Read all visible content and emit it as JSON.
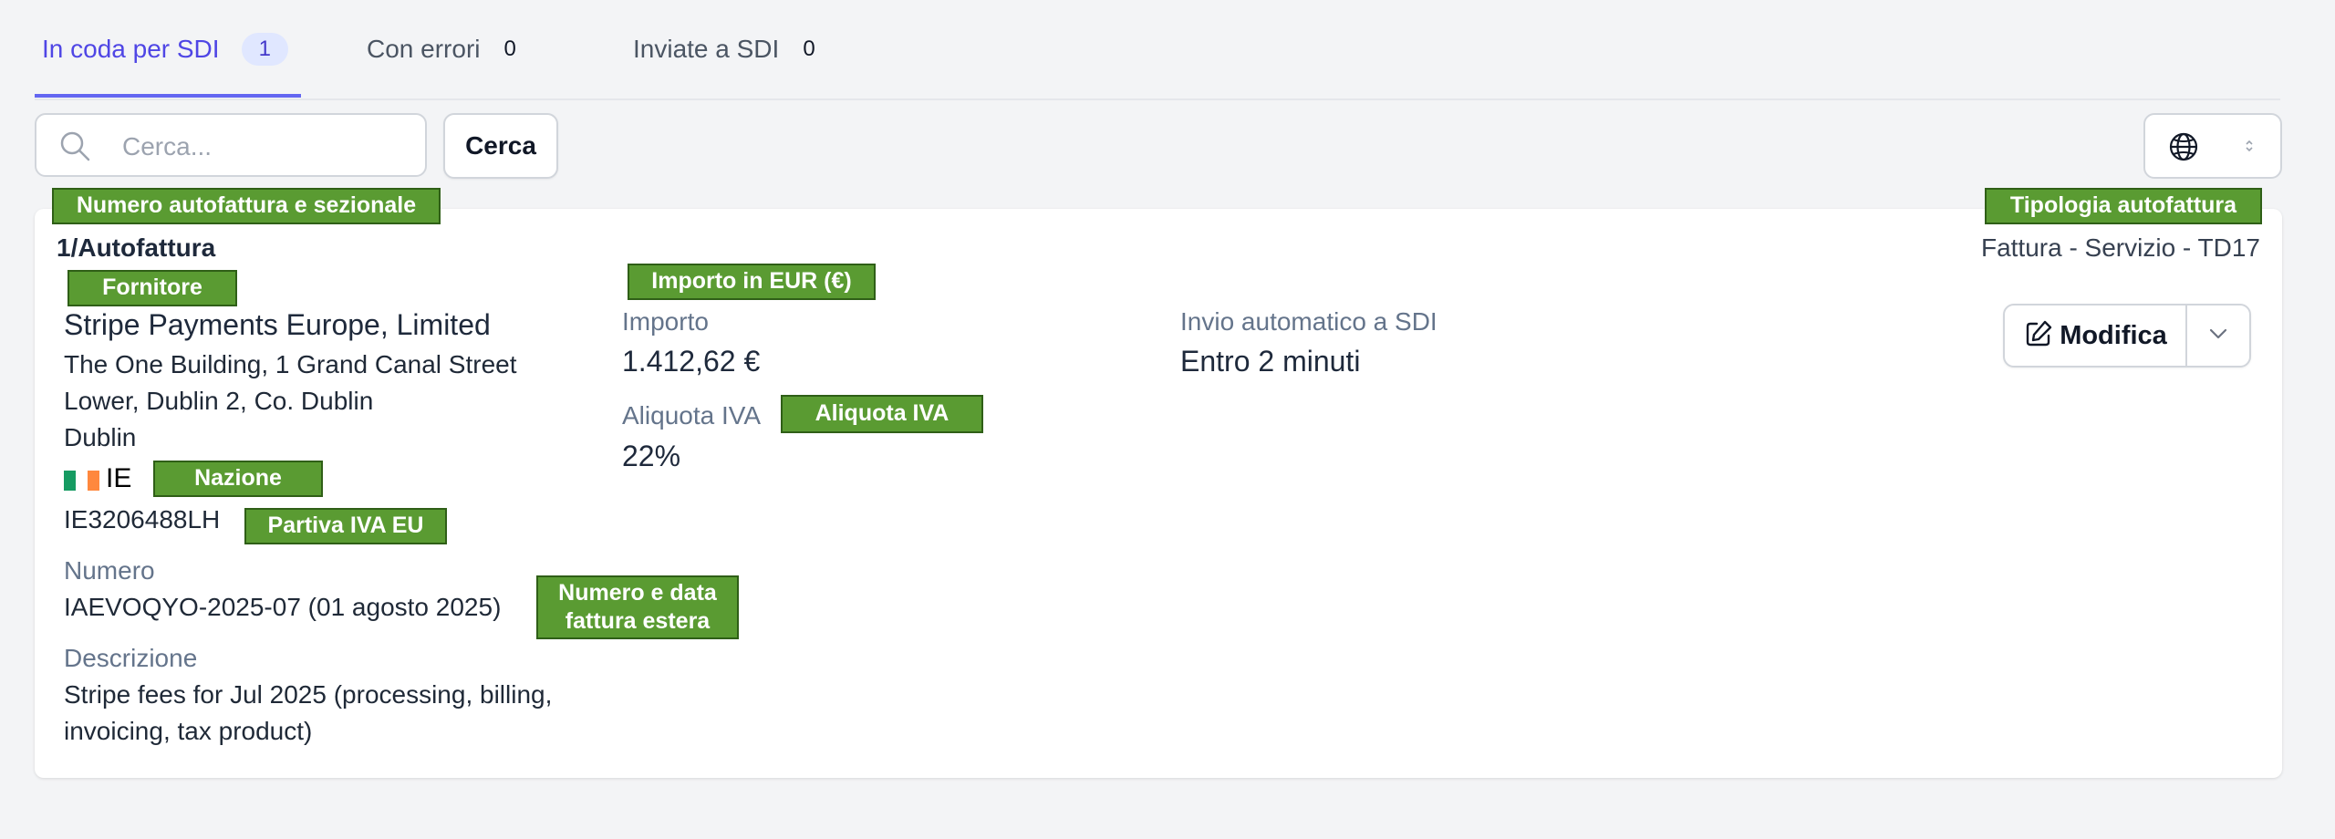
{
  "tabs": [
    {
      "label": "In coda per SDI",
      "count": "1"
    },
    {
      "label": "Con errori",
      "count": "0"
    },
    {
      "label": "Inviate a SDI",
      "count": "0"
    }
  ],
  "search": {
    "placeholder": "Cerca...",
    "button_label": "Cerca"
  },
  "colors": {
    "accent": "#4f46e5",
    "tag_bg": "#5a9b32",
    "tag_border": "#2f5f17"
  },
  "icons": [
    "search-icon",
    "globe-icon",
    "select-arrows-icon",
    "edit-icon",
    "chevron-down-icon",
    "flag-ie-icon"
  ],
  "card": {
    "invoice_number": "1/Autofattura",
    "invoice_type": "Fattura - Servizio - TD17",
    "supplier": {
      "name": "Stripe Payments Europe, Limited",
      "address_line1": "The One Building, 1 Grand Canal Street",
      "address_line2": "Lower, Dublin 2, Co. Dublin",
      "city": "Dublin",
      "country_code": "IE",
      "vat_number": "IE3206488LH"
    },
    "number_label": "Numero",
    "number_value": "IAEVOQYO-2025-07 (01 agosto 2025)",
    "description_label": "Descrizione",
    "description_line1": "Stripe fees for Jul 2025 (processing, billing,",
    "description_line2": "invoicing, tax product)",
    "amount_label": "Importo",
    "amount_value": "1.412,62 €",
    "vat_rate_label": "Aliquota IVA",
    "vat_rate_value": "22%",
    "auto_send_label": "Invio automatico a SDI",
    "auto_send_value": "Entro 2 minuti",
    "edit_button": "Modifica"
  },
  "annotations": {
    "numero_sezionale": "Numero autofattura e sezionale",
    "tipologia": "Tipologia autofattura",
    "fornitore": "Fornitore",
    "importo_eur": "Importo in EUR (€)",
    "aliquota": "Aliquota IVA",
    "nazione": "Nazione",
    "partita_iva": "Partiva IVA EU",
    "numero_data_line1": "Numero e data",
    "numero_data_line2": "fattura estera"
  }
}
